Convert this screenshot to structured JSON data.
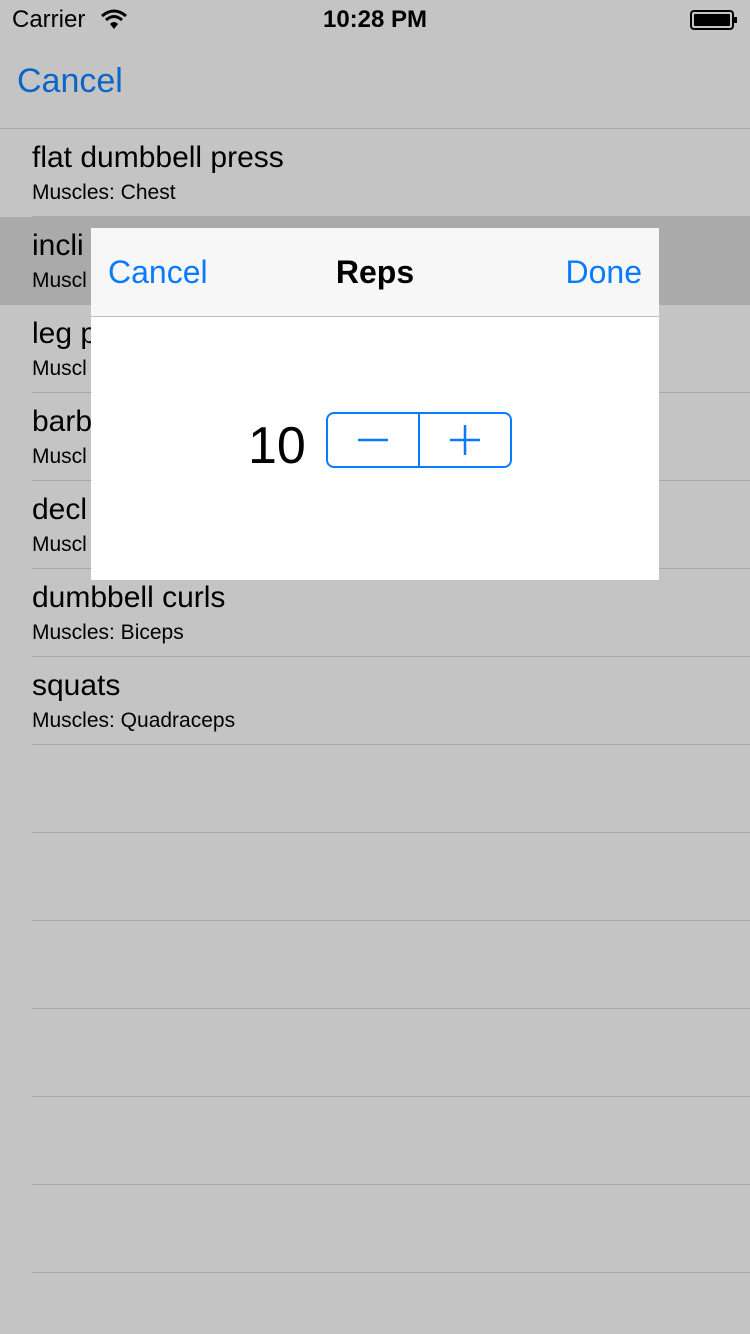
{
  "status": {
    "carrier": "Carrier",
    "time": "10:28 PM"
  },
  "nav": {
    "cancel": "Cancel"
  },
  "exercises": [
    {
      "title": "flat dumbbell press",
      "muscles": "Muscles: Chest"
    },
    {
      "title": "incli",
      "muscles": "Muscl"
    },
    {
      "title": "leg p",
      "muscles": "Muscl"
    },
    {
      "title": "barb",
      "muscles": "Muscl"
    },
    {
      "title": "decl",
      "muscles": "Muscl"
    },
    {
      "title": "dumbbell curls",
      "muscles": "Muscles: Biceps"
    },
    {
      "title": "squats",
      "muscles": "Muscles: Quadraceps"
    }
  ],
  "modal": {
    "cancel": "Cancel",
    "title": "Reps",
    "done": "Done",
    "value": "10"
  },
  "colors": {
    "accent": "#0a7bff",
    "overlay_bg": "#c4c4c4"
  }
}
